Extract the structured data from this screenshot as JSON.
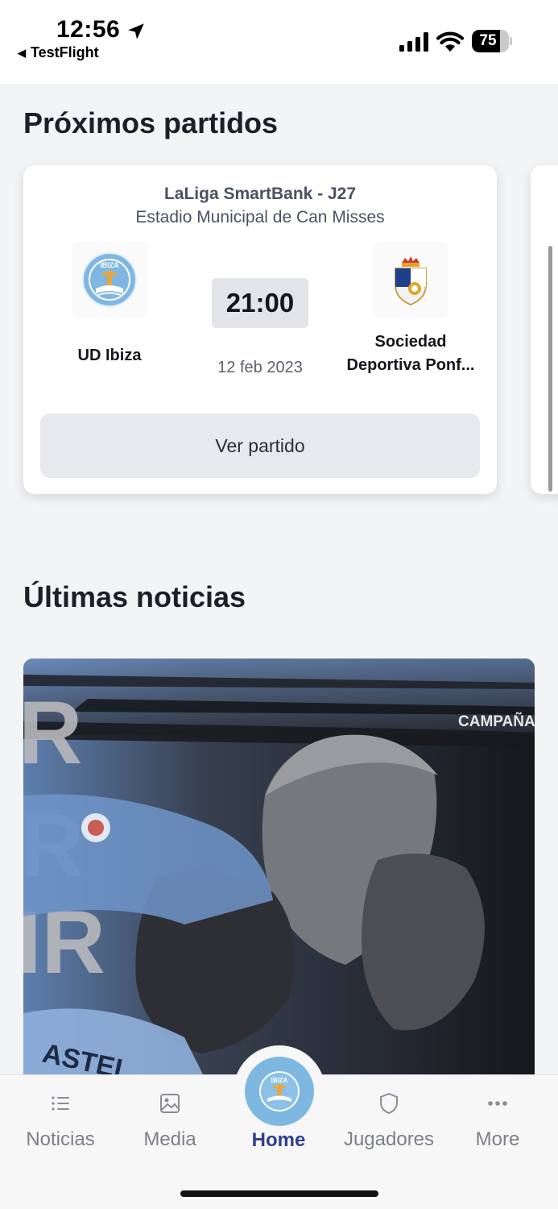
{
  "status_bar": {
    "time": "12:56",
    "back_app": "TestFlight",
    "battery_level": "75",
    "battery_fraction": 0.75
  },
  "upcoming": {
    "title": "Próximos partidos",
    "match": {
      "competition": "LaLiga SmartBank - J27",
      "stadium": "Estadio Municipal de Can Misses",
      "home_team": "UD Ibiza",
      "away_team": "Sociedad Deportiva Ponf...",
      "kickoff_time": "21:00",
      "date": "12 feb 2023",
      "view_button": "Ver partido"
    }
  },
  "news": {
    "title": "Últimas noticias",
    "overlay_text": "CAMPAÑA DE",
    "jersey_text": "ASTEL"
  },
  "bottom_nav": {
    "items": [
      {
        "label": "Noticias",
        "icon": "list-icon"
      },
      {
        "label": "Media",
        "icon": "image-icon"
      },
      {
        "label": "Home",
        "icon": "club-logo-icon",
        "active": true
      },
      {
        "label": "Jugadores",
        "icon": "shield-icon"
      },
      {
        "label": "More",
        "icon": "more-dots-icon"
      }
    ]
  },
  "colors": {
    "accent": "#2f3f8f",
    "club_blue": "#7eb8e0",
    "background": "#f3f4f6"
  }
}
